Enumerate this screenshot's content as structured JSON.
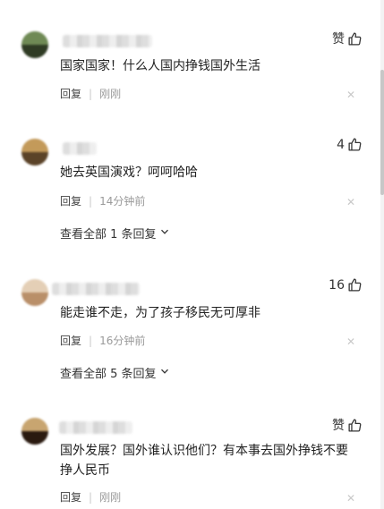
{
  "comments": [
    {
      "avatar_colors": [
        "#6f8a55",
        "#2f3b24"
      ],
      "like_label": "赞",
      "text": "国家国家！什么人国内挣钱国外生活",
      "reply_label": "回复",
      "time": "刚刚",
      "more": null
    },
    {
      "avatar_colors": [
        "#c39a5a",
        "#5b4328"
      ],
      "like_label": "4",
      "text": "她去英国演戏？呵呵哈哈",
      "reply_label": "回复",
      "time": "14分钟前",
      "more": "查看全部 1 条回复"
    },
    {
      "avatar_colors": [
        "#e4cfb6",
        "#b98f69"
      ],
      "like_label": "16",
      "text": "能走谁不走，为了孩子移民无可厚非",
      "reply_label": "回复",
      "time": "16分钟前",
      "more": "查看全部 5 条回复"
    },
    {
      "avatar_colors": [
        "#c8a570",
        "#2a1a10"
      ],
      "like_label": "赞",
      "text": "国外发展？国外谁认识他们？有本事去国外挣钱不要挣人民币",
      "reply_label": "回复",
      "time": "刚刚",
      "more": null
    }
  ],
  "icons": {
    "like": "thumbs-up-icon",
    "close": "close-icon",
    "expand": "chevron-down-icon"
  }
}
